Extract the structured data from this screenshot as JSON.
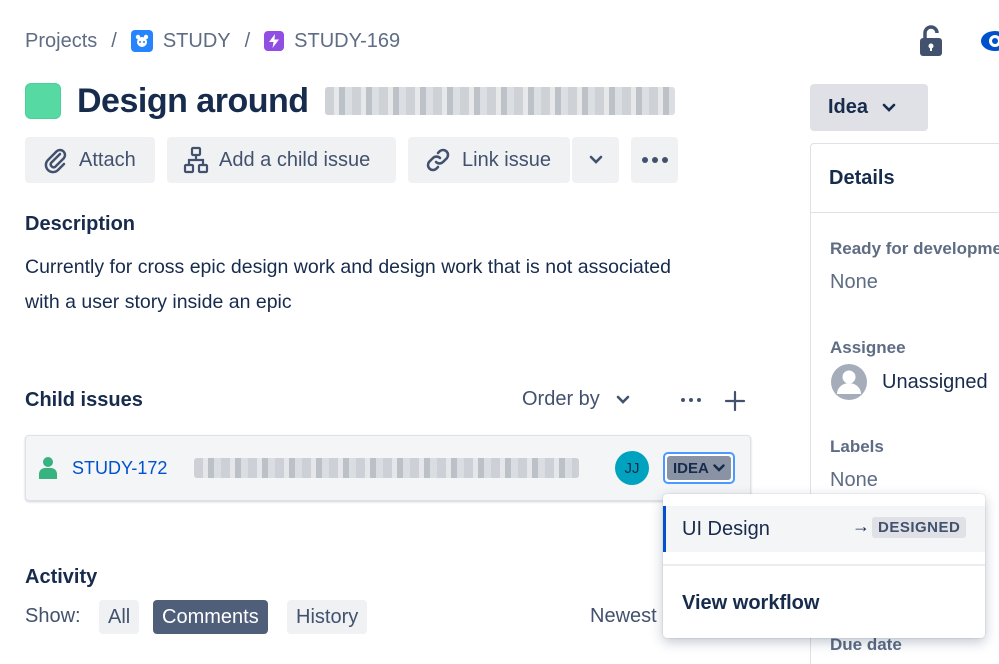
{
  "breadcrumb": {
    "projects": "Projects",
    "separator": "/",
    "project": "STUDY",
    "issue_key": "STUDY-169"
  },
  "issue": {
    "title": "Design around",
    "type_color": "#57d9a3"
  },
  "toolbar": {
    "attach": "Attach",
    "add_child": "Add a child issue",
    "link_issue": "Link issue"
  },
  "description": {
    "heading": "Description",
    "line1": "Currently for cross epic design work and design work that is not associated",
    "line2": "with a user story inside an epic"
  },
  "child_issues": {
    "heading": "Child issues",
    "order_by": "Order by",
    "items": [
      {
        "key": "STUDY-172",
        "assignee_initials": "JJ",
        "status": "IDEA"
      }
    ]
  },
  "activity": {
    "heading": "Activity",
    "show_label": "Show:",
    "filters": [
      "All",
      "Comments",
      "History"
    ],
    "selected": "Comments",
    "sort": "Newest"
  },
  "status_button": {
    "label": "Idea"
  },
  "details": {
    "heading": "Details",
    "ready_label": "Ready for developme",
    "ready_value": "None",
    "assignee_label": "Assignee",
    "assignee_value": "Unassigned",
    "labels_label": "Labels",
    "labels_value": "None",
    "due_date_label": "Due date"
  },
  "transition_menu": {
    "option": "UI Design",
    "arrow": "→",
    "target_status": "DESIGNED",
    "view_workflow": "View workflow"
  },
  "colors": {
    "accent": "#0052cc",
    "status_dark": "#505f79",
    "avatar": "#00a3bf"
  }
}
